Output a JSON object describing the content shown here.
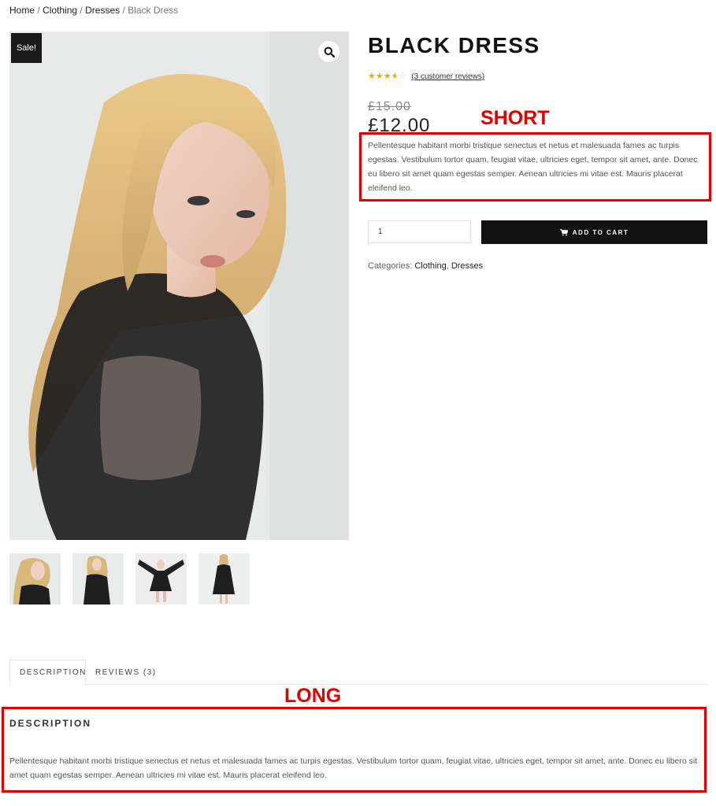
{
  "breadcrumb": {
    "items": [
      "Home",
      "Clothing",
      "Dresses"
    ],
    "separator": "/",
    "current": "Black Dress"
  },
  "gallery": {
    "sale_badge": "Sale!",
    "zoom_icon": "search-icon",
    "thumbnail_count": 4
  },
  "product": {
    "title": "BLACK DRESS",
    "rating": 3.67,
    "rating_max": 5,
    "review_text": "(3 customer reviews)",
    "old_price": "£15.00",
    "new_price": "£12.00",
    "short_description": "Pellentesque habitant morbi tristique senectus et netus et malesuada fames ac turpis egestas. Vestibulum tortor quam, feugiat vitae, ultricies eget, tempor sit amet, ante. Donec eu libero sit amet quam egestas semper. Aenean ultricies mi vitae est. Mauris placerat eleifend leo.",
    "quantity": "1",
    "add_to_cart_label": "ADD TO CART",
    "cart_icon": "cart-icon",
    "categories_label": "Categories:",
    "categories": [
      "Clothing",
      "Dresses"
    ]
  },
  "annotations": {
    "short": "SHORT",
    "long": "LONG",
    "color": "#e00000"
  },
  "tabs": [
    {
      "label": "DESCRIPTION",
      "active": true
    },
    {
      "label": "REVIEWS (3)",
      "active": false
    }
  ],
  "description": {
    "heading": "DESCRIPTION",
    "text": "Pellentesque habitant morbi tristique senectus et netus et malesuada fames ac turpis egestas. Vestibulum tortor quam, feugiat vitae, ultricies eget, tempor sit amet, ante. Donec eu libero sit amet quam egestas semper. Aenean ultricies mi vitae est. Mauris placerat eleifend leo."
  }
}
